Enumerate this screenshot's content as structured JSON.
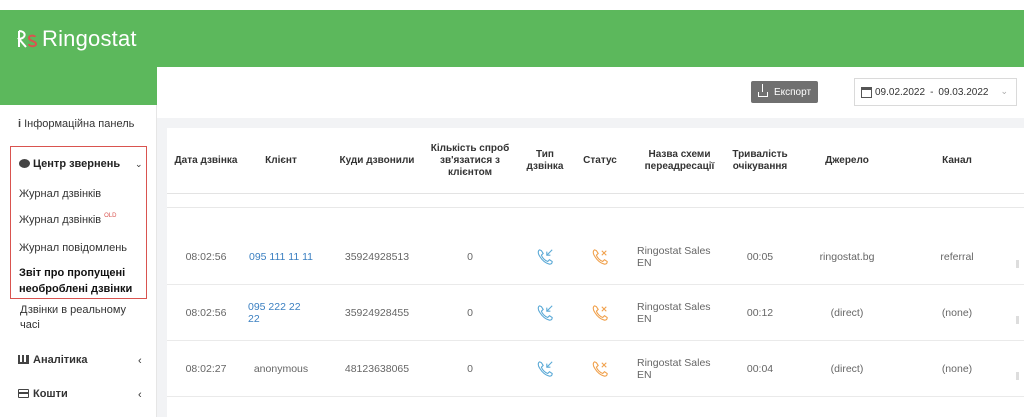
{
  "brand": {
    "name": "Ringostat",
    "color": "#5cb85c"
  },
  "sidebar": {
    "info_panel": "Інформаційна панель",
    "group": {
      "title": "Центр звернень",
      "items": [
        {
          "label": "Журнал дзвінків"
        },
        {
          "label": "Журнал дзвінків",
          "badge": "OLD"
        },
        {
          "label": "Журнал повідомлень"
        },
        {
          "label": "Звіт про пропущені необроблені дзвінки",
          "active": true
        }
      ]
    },
    "realtime": "Дзвінки в реальному часі",
    "analytics": "Аналітика",
    "funds": "Кошти"
  },
  "toolbar": {
    "export_label": "Експорт",
    "date_from": "09.02.2022",
    "date_sep": "-",
    "date_to": "09.03.2022"
  },
  "table": {
    "headers": [
      "Дата дзвінка",
      "Клієнт",
      "Куди дзвонили",
      "Кількість спроб зв'язатися з клієнтом",
      "Тип дзвінка",
      "Статус",
      "Назва схеми переадресації",
      "Тривалість очікування",
      "Джерело",
      "Канал"
    ],
    "rows": [
      {
        "time": "08:02:56",
        "client": "095 111 11 11",
        "called": "35924928513",
        "attempts": "0",
        "type_icon": "incoming-call-icon",
        "status_icon": "missed-call-icon",
        "scheme": "Ringostat Sales EN",
        "wait": "00:05",
        "source": "ringostat.bg",
        "channel": "referral"
      },
      {
        "time": "08:02:56",
        "client": "095 222 22 22",
        "called": "35924928455",
        "attempts": "0",
        "type_icon": "incoming-call-icon",
        "status_icon": "missed-call-icon",
        "scheme": "Ringostat Sales EN",
        "wait": "00:12",
        "source": "(direct)",
        "channel": "(none)"
      },
      {
        "time": "08:02:27",
        "client": "anonymous",
        "called": "48123638065",
        "attempts": "0",
        "type_icon": "incoming-call-icon",
        "status_icon": "missed-call-icon",
        "scheme": "Ringostat Sales EN",
        "wait": "00:04",
        "source": "(direct)",
        "channel": "(none)"
      }
    ]
  },
  "colors": {
    "type_icon": "#5aa9d6",
    "status_icon": "#f0a04b",
    "link": "#3a7fc1",
    "highlight_border": "#d9534f"
  }
}
